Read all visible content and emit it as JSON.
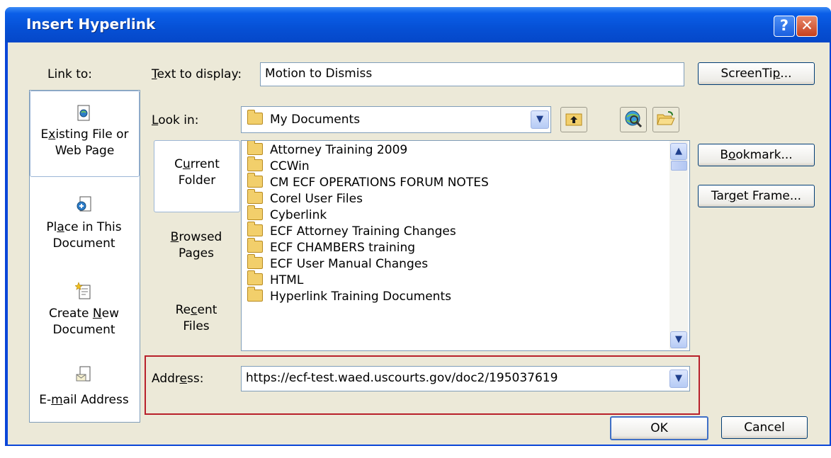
{
  "window": {
    "title": "Insert Hyperlink",
    "help_glyph": "?",
    "close_glyph": "✕"
  },
  "link_to": {
    "label": "Link to:",
    "items": [
      {
        "pre": "E",
        "u": "x",
        "post": "isting File or",
        "line2": "Web Page",
        "icon": "existing-file-icon"
      },
      {
        "pre": "Pl",
        "u": "a",
        "post": "ce in This",
        "line2": "Document",
        "icon": "place-in-document-icon"
      },
      {
        "pre": "Create ",
        "u": "N",
        "post": "ew",
        "line2": "Document",
        "icon": "new-document-icon"
      },
      {
        "pre": "E-",
        "u": "m",
        "post": "ail Address",
        "line2": "",
        "icon": "email-address-icon"
      }
    ]
  },
  "text_to_display": {
    "label_u": "T",
    "label_rest": "ext to display:",
    "value": "Motion to Dismiss"
  },
  "screentip": {
    "pre": "ScreenTi",
    "u": "p",
    "post": "..."
  },
  "look_in": {
    "label_u": "L",
    "label_rest": "ook in:",
    "value": "My Documents"
  },
  "side_tabs": [
    {
      "pre": "C",
      "u": "u",
      "post": "rrent",
      "line2": "Folder"
    },
    {
      "pre": "",
      "u": "B",
      "post": "rowsed",
      "line2": "Pages"
    },
    {
      "pre": "Re",
      "u": "c",
      "post": "ent",
      "line2": "Files"
    }
  ],
  "files": [
    "Attorney Training 2009",
    "CCWin",
    "CM ECF OPERATIONS FORUM NOTES",
    "Corel User Files",
    "Cyberlink",
    "ECF Attorney Training Changes",
    "ECF CHAMBERS training",
    "ECF User Manual Changes",
    "HTML",
    "Hyperlink Training Documents"
  ],
  "bookmark": {
    "pre": "B",
    "u": "o",
    "post": "okmark..."
  },
  "target_frame": {
    "pre": "Tar",
    "u": "g",
    "post": "et Frame..."
  },
  "address": {
    "pre": "Addr",
    "u": "e",
    "post": "ss:",
    "value": "https://ecf-test.waed.uscourts.gov/doc2/195037619"
  },
  "ok_label": "OK",
  "cancel_label": "Cancel",
  "colors": {
    "highlight_box": "#b8202a",
    "title_bar": "#0a5ee8"
  }
}
